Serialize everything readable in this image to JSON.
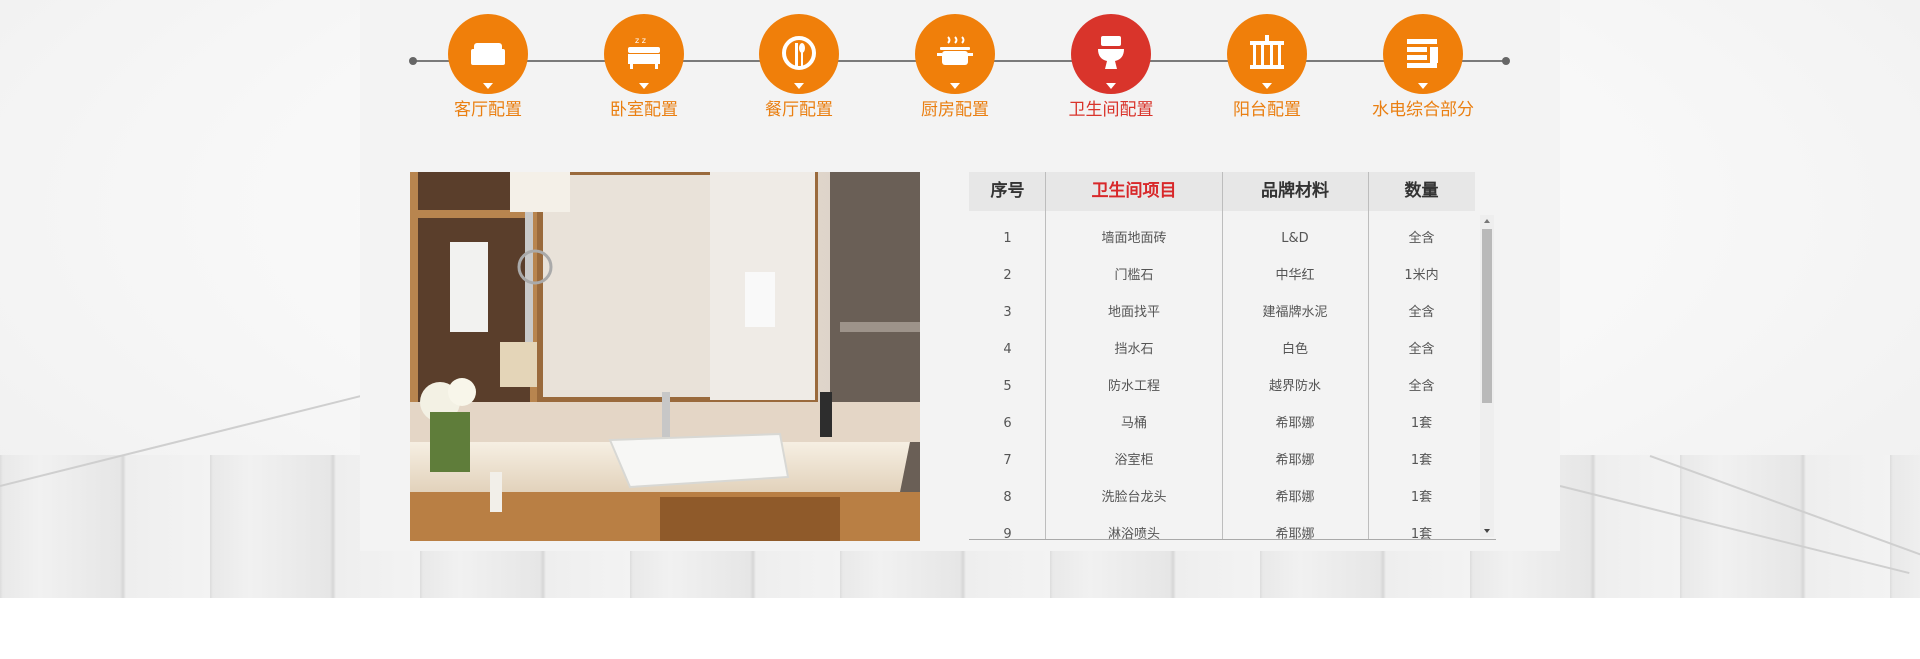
{
  "colors": {
    "accent_orange": "#f07f0a",
    "active_red": "#d9342b",
    "label_orange": "#ea7f11",
    "header_red": "#d8282a"
  },
  "categories": [
    {
      "label": "客厅配置",
      "icon": "sofa-icon",
      "active": false
    },
    {
      "label": "卧室配置",
      "icon": "bed-icon",
      "active": false
    },
    {
      "label": "餐厅配置",
      "icon": "dining-plate-icon",
      "active": false
    },
    {
      "label": "厨房配置",
      "icon": "cooking-pot-icon",
      "active": false
    },
    {
      "label": "卫生间配置",
      "icon": "toilet-icon",
      "active": true
    },
    {
      "label": "阳台配置",
      "icon": "balcony-railing-icon",
      "active": false
    },
    {
      "label": "水电综合部分",
      "icon": "plumbing-electric-icon",
      "active": false
    }
  ],
  "table": {
    "headers": [
      "序号",
      "卫生间项目",
      "品牌材料",
      "数量"
    ],
    "rows": [
      [
        "1",
        "墙面地面砖",
        "L&D",
        "全含"
      ],
      [
        "2",
        "门槛石",
        "中华红",
        "1米内"
      ],
      [
        "3",
        "地面找平",
        "建福牌水泥",
        "全含"
      ],
      [
        "4",
        "挡水石",
        "白色",
        "全含"
      ],
      [
        "5",
        "防水工程",
        "越界防水",
        "全含"
      ],
      [
        "6",
        "马桶",
        "希耶娜",
        "1套"
      ],
      [
        "7",
        "浴室柜",
        "希耶娜",
        "1套"
      ],
      [
        "8",
        "洗脸台龙头",
        "希耶娜",
        "1套"
      ],
      [
        "9",
        "淋浴喷头",
        "希耶娜",
        "1套"
      ]
    ]
  }
}
